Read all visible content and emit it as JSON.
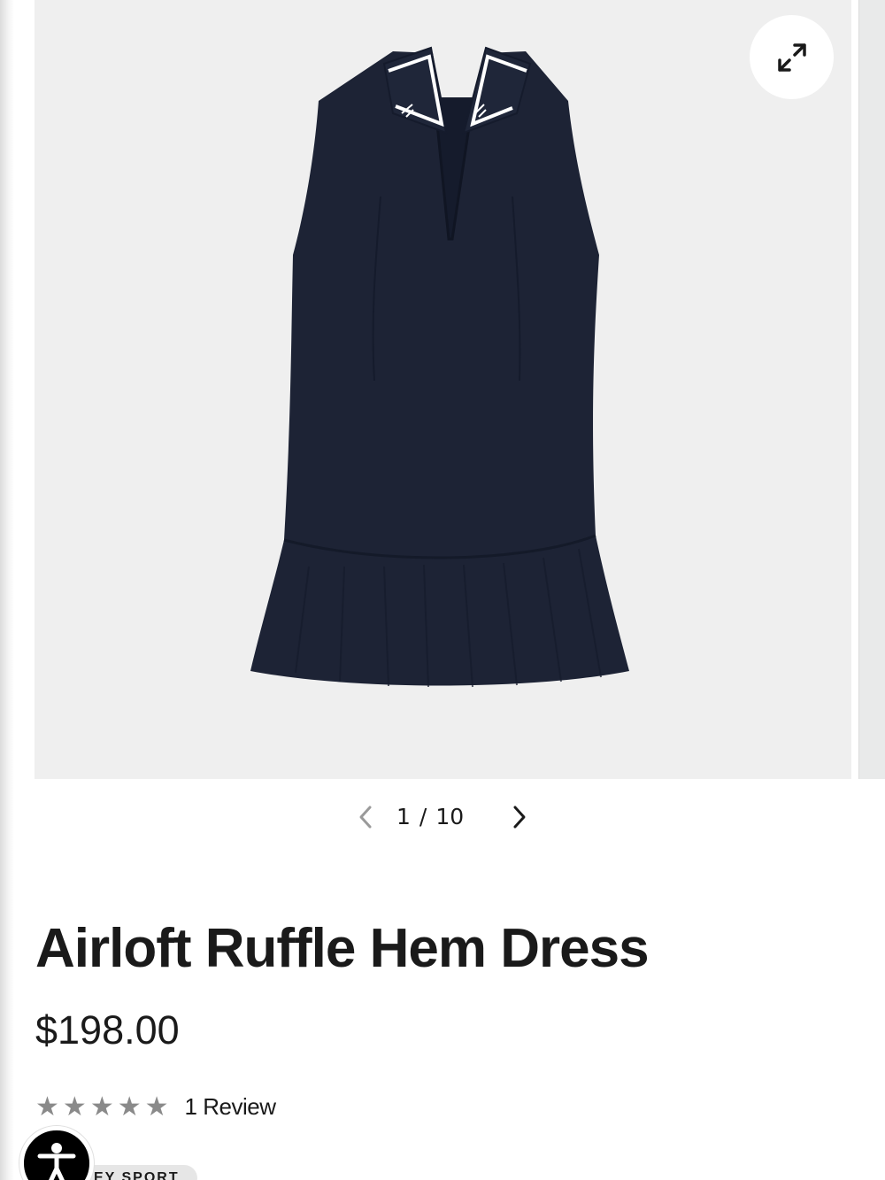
{
  "gallery": {
    "image_alt": "Navy sleeveless polo dress with ruffle hem",
    "expand_icon": "expand-arrows-icon",
    "pager": {
      "current": "1",
      "separator": "/",
      "total": "10",
      "prev_icon": "chevron-left-icon",
      "next_icon": "chevron-right-icon"
    }
  },
  "product": {
    "title": "Airloft Ruffle Hem Dress",
    "price": "$198.00",
    "rating": {
      "stars": 5,
      "filled": 0,
      "review_label": "1 Review"
    },
    "tag": "EY SPORT"
  },
  "accessibility": {
    "icon": "accessibility-person-icon"
  },
  "colors": {
    "dress": "#1d2335",
    "image_bg": "#efefef",
    "star": "#8a8a8a",
    "text": "#1a1a1a"
  }
}
